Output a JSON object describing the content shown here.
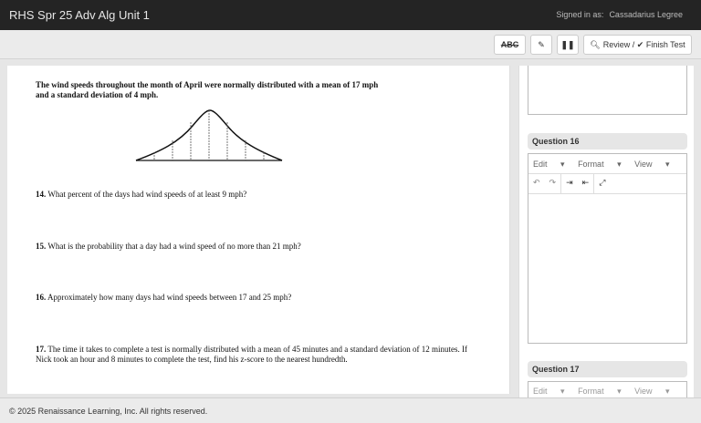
{
  "header": {
    "title": "RHS Spr 25 Adv Alg Unit 1",
    "signed_in_label": "Signed in as:",
    "user": "Cassadarius Legree"
  },
  "toolbar": {
    "abc": "ABC",
    "review": "Review /",
    "finish": "Finish Test"
  },
  "content": {
    "intro": "The wind speeds throughout the month of April were normally distributed with a mean of 17 mph and a standard deviation of 4 mph.",
    "questions": [
      {
        "num": "14.",
        "text": "What percent of the days had wind speeds of at least 9 mph?"
      },
      {
        "num": "15.",
        "text": "What is the probability that a day had a wind speed of no more than 21 mph?"
      },
      {
        "num": "16.",
        "text": "Approximately how many days had wind speeds between 17 and 25 mph?"
      },
      {
        "num": "17.",
        "text": "The time it takes to complete a test is normally distributed with a mean of 45 minutes and a standard deviation of 12 minutes. If Nick took an hour and 8 minutes to complete the test, find his z-score to the nearest hundredth."
      }
    ]
  },
  "answers": {
    "q16": {
      "title": "Question 16",
      "menu": [
        "Edit",
        "Format",
        "View"
      ]
    },
    "q17": {
      "title": "Question 17",
      "menu": [
        "Edit",
        "Format",
        "View"
      ]
    }
  },
  "footer": {
    "text": "© 2025 Renaissance Learning, Inc. All rights reserved."
  }
}
